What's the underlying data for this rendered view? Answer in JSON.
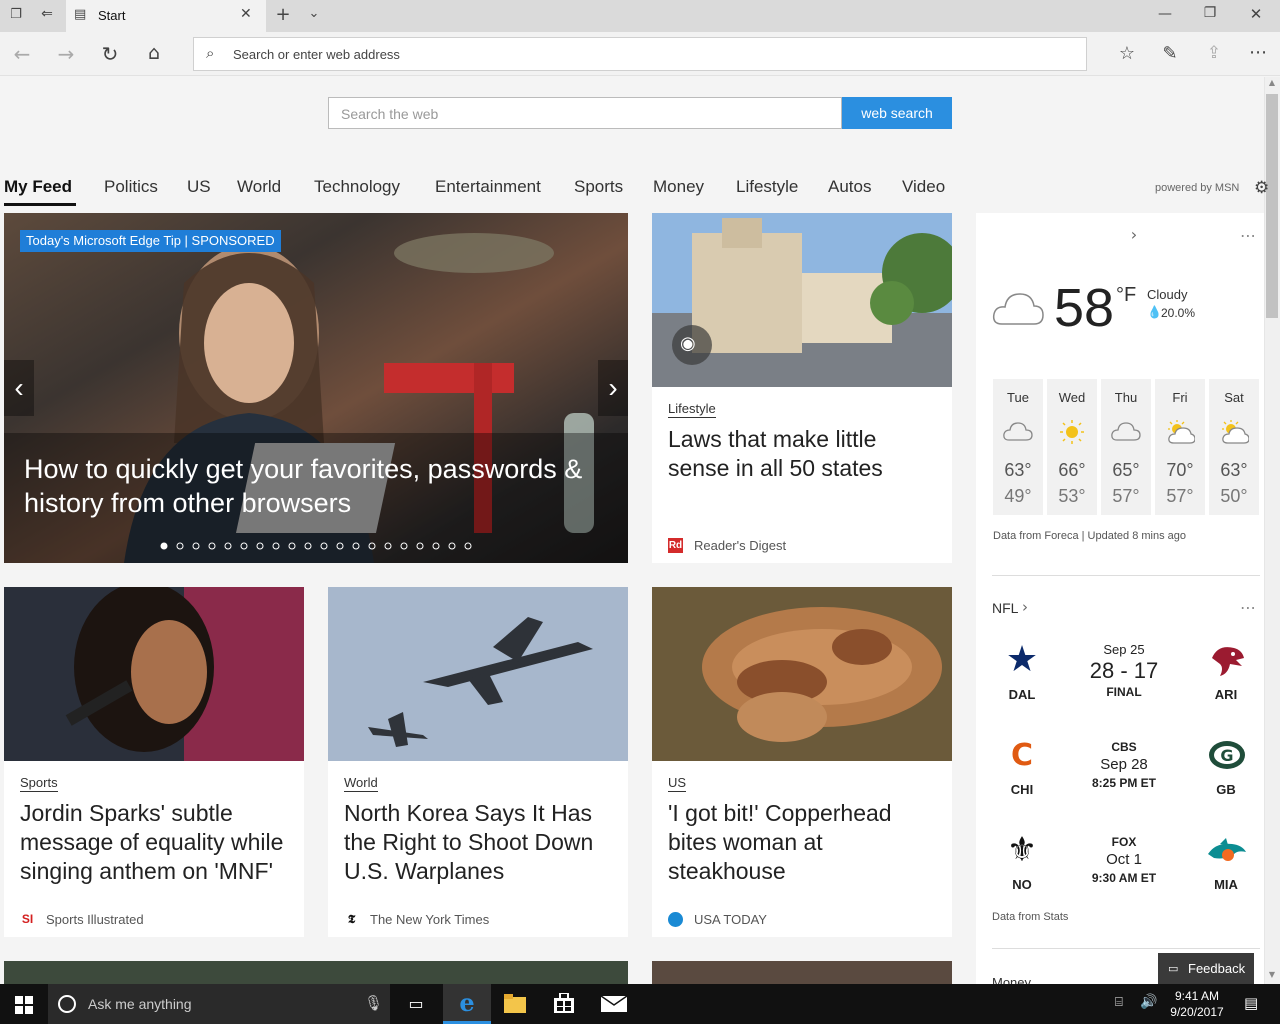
{
  "window": {
    "tab_title": "Start"
  },
  "address_bar": {
    "placeholder": "Search or enter web address"
  },
  "search": {
    "placeholder": "Search the web",
    "button": "web search"
  },
  "nav": {
    "items": [
      "My Feed",
      "Politics",
      "US",
      "World",
      "Technology",
      "Entertainment",
      "Sports",
      "Money",
      "Lifestyle",
      "Autos",
      "Video"
    ],
    "powered_by": "powered by MSN"
  },
  "hero": {
    "badge": "Today's Microsoft Edge Tip | SPONSORED",
    "title": "How to quickly get your favorites, passwords & history from other browsers",
    "dots": 20,
    "active_dot": 0
  },
  "cards": [
    {
      "category": "Lifestyle",
      "title": "Laws that make little sense in all 50 states",
      "source": "Reader's Digest"
    },
    {
      "category": "Sports",
      "title": "Jordin Sparks' subtle message of equality while singing anthem on 'MNF'",
      "source": "Sports Illustrated"
    },
    {
      "category": "World",
      "title": "North Korea Says It Has the Right to Shoot Down U.S. Warplanes",
      "source": "The New York Times"
    },
    {
      "category": "US",
      "title": "'I got bit!' Copperhead bites woman at steakhouse",
      "source": "USA TODAY"
    }
  ],
  "weather": {
    "temp": "58",
    "unit": "°F",
    "condition": "Cloudy",
    "precip": "20.0%",
    "forecast": [
      {
        "day": "Tue",
        "hi": "63°",
        "lo": "49°",
        "icon": "cloudy-icon"
      },
      {
        "day": "Wed",
        "hi": "66°",
        "lo": "53°",
        "icon": "sunny-icon"
      },
      {
        "day": "Thu",
        "hi": "65°",
        "lo": "57°",
        "icon": "cloudy-icon"
      },
      {
        "day": "Fri",
        "hi": "70°",
        "lo": "57°",
        "icon": "partly-sunny-icon"
      },
      {
        "day": "Sat",
        "hi": "63°",
        "lo": "50°",
        "icon": "partly-sunny-icon"
      }
    ],
    "credit": "Data from Foreca | Updated 8 mins ago"
  },
  "nfl": {
    "title": "NFL",
    "games": [
      {
        "home": "DAL",
        "away": "ARI",
        "line1": "Sep 25",
        "line2": "28 - 17",
        "line3": "FINAL"
      },
      {
        "home": "CHI",
        "away": "GB",
        "line1": "CBS",
        "line2": "Sep 28",
        "line3": "8:25 PM ET"
      },
      {
        "home": "NO",
        "away": "MIA",
        "line1": "FOX",
        "line2": "Oct 1",
        "line3": "9:30 AM ET"
      }
    ],
    "credit": "Data from Stats"
  },
  "money_label": "Money",
  "feedback": "Feedback",
  "taskbar": {
    "cortana": "Ask me anything",
    "time": "9:41 AM",
    "date": "9/20/2017"
  },
  "colors": {
    "accent": "#2b8fe0",
    "badge": "#1f7ed8"
  }
}
